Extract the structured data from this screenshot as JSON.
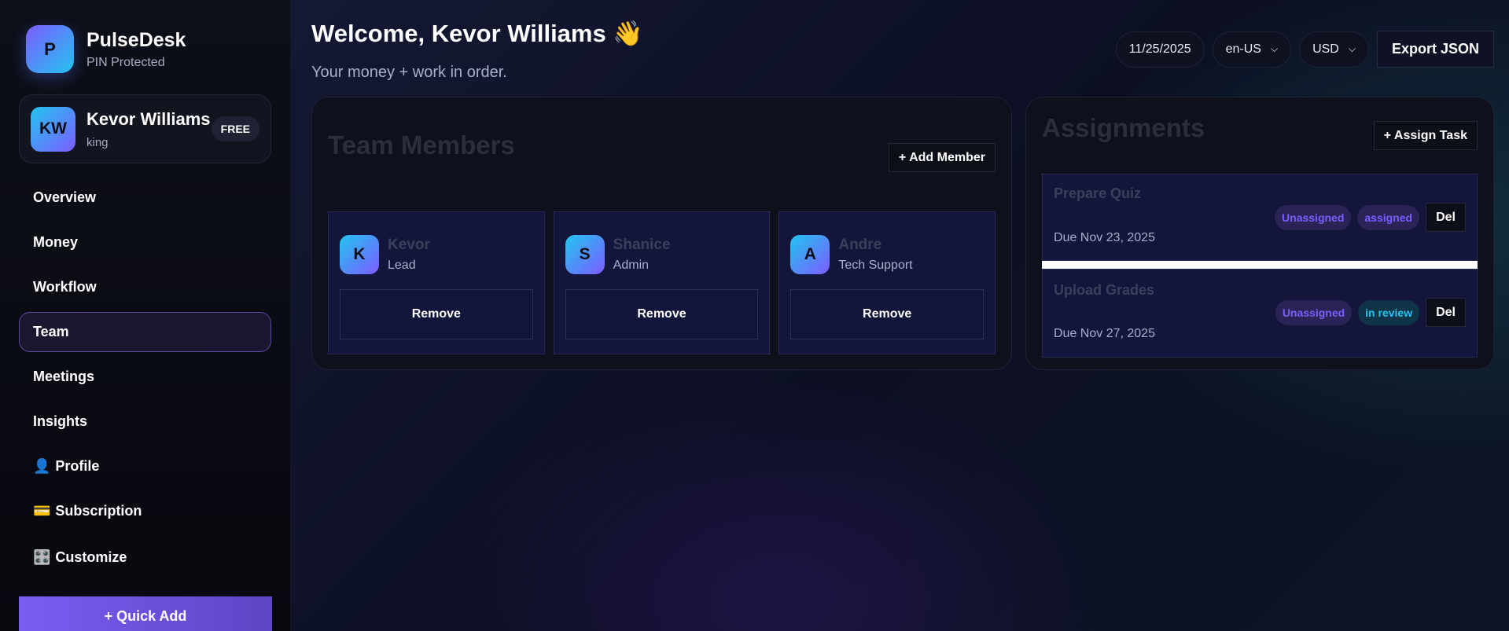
{
  "brand": {
    "logo_letter": "P",
    "name": "PulseDesk",
    "subtitle": "PIN Protected"
  },
  "user": {
    "initials": "KW",
    "name": "Kevor Williams",
    "handle": "king",
    "plan": "FREE"
  },
  "nav": [
    {
      "label": "Overview",
      "icon": ""
    },
    {
      "label": "Money",
      "icon": ""
    },
    {
      "label": "Workflow",
      "icon": ""
    },
    {
      "label": "Team",
      "icon": "",
      "active": true
    },
    {
      "label": "Meetings",
      "icon": ""
    },
    {
      "label": "Insights",
      "icon": ""
    },
    {
      "label": "Profile",
      "icon": "👤"
    },
    {
      "label": "Subscription",
      "icon": "💳"
    },
    {
      "label": "Customize",
      "icon": "🎛️"
    }
  ],
  "quick_add_label": "+ Quick Add",
  "header": {
    "welcome": "Welcome, Kevor Williams 👋",
    "tagline": "Your money + work in order.",
    "date": "11/25/2025",
    "locale": "en-US",
    "currency": "USD",
    "export_label": "Export JSON"
  },
  "team": {
    "title": "Team Members",
    "add_label": "+ Add Member",
    "remove_label": "Remove",
    "members": [
      {
        "initial": "K",
        "name": "Kevor",
        "role": "Lead"
      },
      {
        "initial": "S",
        "name": "Shanice",
        "role": "Admin"
      },
      {
        "initial": "A",
        "name": "Andre",
        "role": "Tech Support"
      }
    ]
  },
  "assignments": {
    "title": "Assignments",
    "assign_label": "+ Assign Task",
    "delete_label": "Del",
    "tasks": [
      {
        "title": "Prepare Quiz",
        "due": "Due Nov 23, 2025",
        "assignee": "Unassigned",
        "status": "assigned"
      },
      {
        "title": "Upload Grades",
        "due": "Due Nov 27, 2025",
        "assignee": "Unassigned",
        "status": "in review"
      }
    ]
  },
  "colors": {
    "accent": "#7c5cff",
    "cyan": "#22c4f0",
    "bg": "#0b0d1a"
  }
}
